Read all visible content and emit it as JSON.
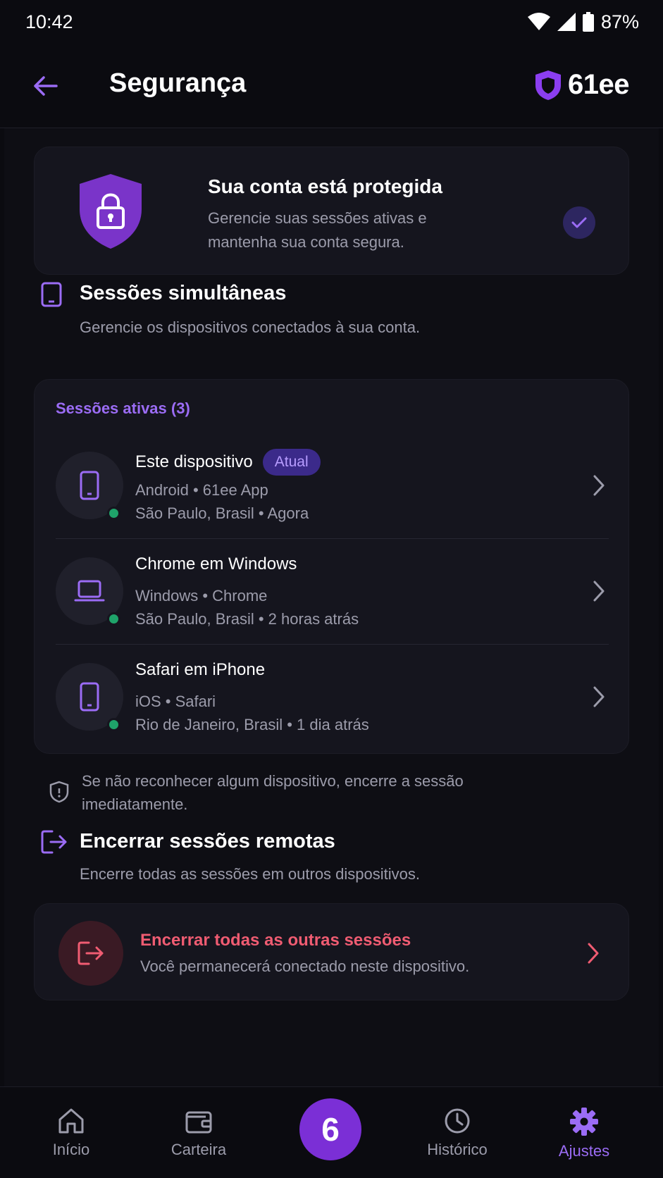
{
  "status_bar": {
    "time": "10:42",
    "battery": "87%"
  },
  "header": {
    "title": "Segurança",
    "brand": "61ee"
  },
  "protection": {
    "title": "Sua conta está protegida",
    "description": "Gerencie suas sessões ativas e mantenha sua conta segura."
  },
  "sessions_section": {
    "title": "Sessões simultâneas",
    "description": "Gerencie os dispositivos conectados à sua conta.",
    "active_label": "Sessões ativas (3)",
    "items": [
      {
        "name": "Este dispositivo",
        "badge": "Atual",
        "line1": "Android • 61ee App",
        "line2": "São Paulo, Brasil • Agora",
        "icon": "phone-icon",
        "online": true
      },
      {
        "name": "Chrome em Windows",
        "line1": "Windows • Chrome",
        "line2": "São Paulo, Brasil • 2 horas atrás",
        "icon": "laptop-icon",
        "online": true
      },
      {
        "name": "Safari em iPhone",
        "line1": "iOS • Safari",
        "line2": "Rio de Janeiro, Brasil • 1 dia atrás",
        "icon": "phone-icon",
        "online": true
      }
    ]
  },
  "warning": {
    "text": "Se não reconhecer algum dispositivo, encerre a sessão imediatamente."
  },
  "remote_section": {
    "title": "Encerrar sessões remotas",
    "description": "Encerre todas as sessões em outros dispositivos.",
    "action_title": "Encerrar todas as outras sessões",
    "action_desc": "Você permanecerá conectado neste dispositivo."
  },
  "nav": {
    "items": [
      {
        "label": "Início",
        "icon": "home-icon"
      },
      {
        "label": "Carteira",
        "icon": "wallet-icon"
      },
      {
        "label": "6",
        "icon": "center-logo"
      },
      {
        "label": "Histórico",
        "icon": "clock-icon"
      },
      {
        "label": "Ajustes",
        "icon": "gear-icon",
        "active": true
      }
    ]
  },
  "colors": {
    "accent": "#9b6cf5",
    "danger": "#f05c72",
    "online": "#1fa36a",
    "background": "#0b0b10"
  }
}
